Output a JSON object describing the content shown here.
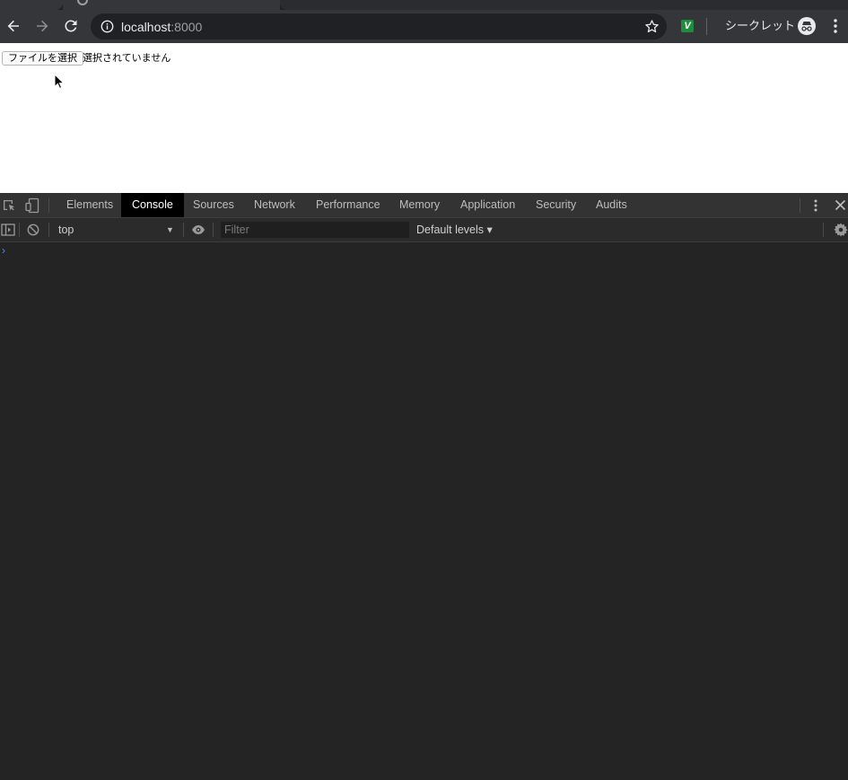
{
  "browser": {
    "url_host": "localhost",
    "url_port": ":8000",
    "incognito_label": "シークレット",
    "extension_letter": "V"
  },
  "page": {
    "file_button_label": "ファイルを選択",
    "file_status": "選択されていません"
  },
  "devtools": {
    "tabs": [
      {
        "label": "Elements",
        "active": false
      },
      {
        "label": "Console",
        "active": true
      },
      {
        "label": "Sources",
        "active": false
      },
      {
        "label": "Network",
        "active": false
      },
      {
        "label": "Performance",
        "active": false
      },
      {
        "label": "Memory",
        "active": false
      },
      {
        "label": "Application",
        "active": false
      },
      {
        "label": "Security",
        "active": false
      },
      {
        "label": "Audits",
        "active": false
      }
    ],
    "console": {
      "context": "top",
      "filter_placeholder": "Filter",
      "levels_label": "Default levels ▾",
      "prompt_symbol": "›"
    }
  },
  "colors": {
    "devtools_bg": "#242424",
    "active_tab_bg": "#000000",
    "prompt_blue": "#4d8bf5",
    "extension_green": "#1e8e3e"
  }
}
